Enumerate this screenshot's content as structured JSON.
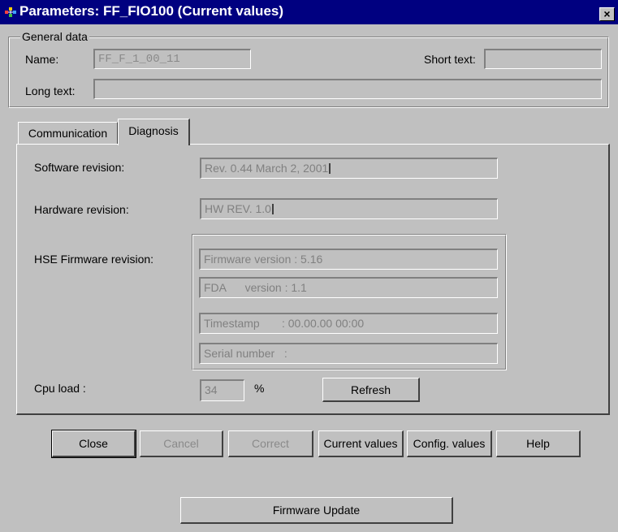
{
  "window": {
    "title": "Parameters: FF_FIO100 (Current values)",
    "close_glyph": "×",
    "icon": "app-icon"
  },
  "general": {
    "legend": "General data",
    "name_label": "Name:",
    "name_value": "FF_F_1_00_11",
    "short_text_label": "Short text:",
    "short_text_value": "",
    "long_text_label": "Long text:",
    "long_text_value": ""
  },
  "tabs": [
    {
      "label": "Communication",
      "active": false
    },
    {
      "label": "Diagnosis",
      "active": true
    }
  ],
  "diagnosis": {
    "software_label": "Software revision:",
    "software_value": "Rev. 0.44 March 2, 2001",
    "hardware_label": "Hardware revision:",
    "hardware_value": "HW REV. 1.0",
    "hse_label": "HSE Firmware revision:",
    "hse_fields": [
      "Firmware version : 5.16",
      "FDA      version : 1.1",
      "Timestamp       : 00.00.00 00:00",
      "Serial number   :"
    ],
    "cpu_label": "Cpu load :",
    "cpu_value": "34",
    "cpu_unit": "%",
    "refresh_label": "Refresh"
  },
  "buttons": {
    "close": "Close",
    "cancel": "Cancel",
    "correct": "Correct",
    "current_values": "Current values",
    "config_values": "Config. values",
    "help": "Help",
    "firmware_update": "Firmware Update"
  },
  "colors": {
    "title_bar": "#000080",
    "face": "#c0c0c0",
    "disabled_text": "#808080"
  }
}
